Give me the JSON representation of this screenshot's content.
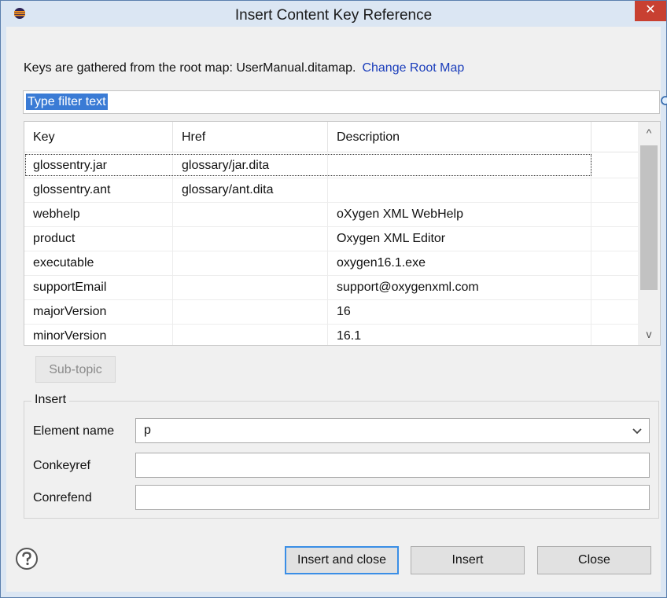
{
  "window": {
    "title": "Insert Content Key Reference",
    "close_glyph": "✕",
    "icon": "eclipse-app-icon"
  },
  "info": {
    "text": "Keys are gathered from the root map: UserManual.ditamap.",
    "link": "Change Root Map"
  },
  "filter": {
    "value": "Type filter text",
    "icon": "search-icon"
  },
  "table": {
    "columns": [
      "Key",
      "Href",
      "Description"
    ],
    "rows": [
      {
        "key": "glossentry.jar",
        "href": "glossary/jar.dita",
        "description": ""
      },
      {
        "key": "glossentry.ant",
        "href": "glossary/ant.dita",
        "description": ""
      },
      {
        "key": "webhelp",
        "href": "",
        "description": "oXygen XML WebHelp"
      },
      {
        "key": "product",
        "href": "",
        "description": "Oxygen XML Editor"
      },
      {
        "key": "executable",
        "href": "",
        "description": "oxygen16.1.exe"
      },
      {
        "key": "supportEmail",
        "href": "",
        "description": "support@oxygenxml.com"
      },
      {
        "key": "majorVersion",
        "href": "",
        "description": "16"
      },
      {
        "key": "minorVersion",
        "href": "",
        "description": "16.1"
      }
    ],
    "scroll_up": "^",
    "scroll_down": "v"
  },
  "subtopic_button": "Sub-topic",
  "insert_group": {
    "label": "Insert",
    "element_name_label": "Element name",
    "element_name_value": "p",
    "conkeyref_label": "Conkeyref",
    "conkeyref_value": "",
    "conrefend_label": "Conrefend",
    "conrefend_value": ""
  },
  "buttons": {
    "insert_and_close": "Insert and close",
    "insert": "Insert",
    "close": "Close"
  },
  "colors": {
    "accent": "#3a7bd5",
    "link": "#1a3dbb",
    "close_button": "#c84031"
  }
}
